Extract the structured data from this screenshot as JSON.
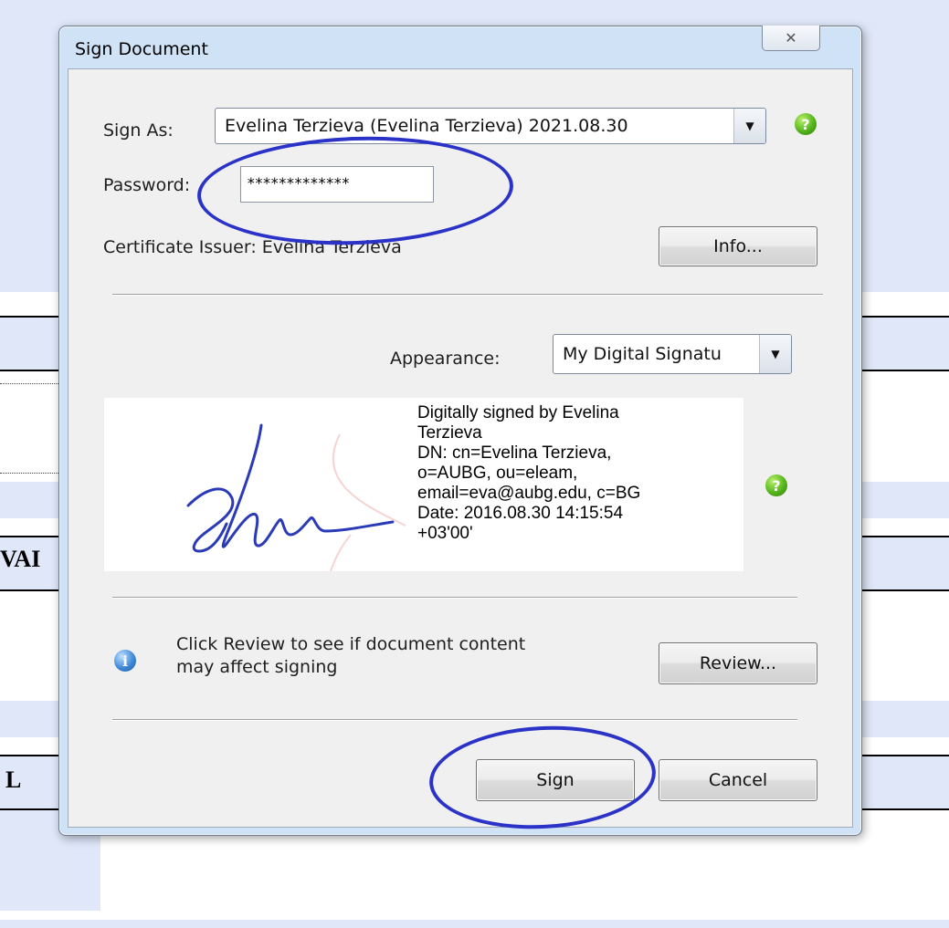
{
  "background": {
    "text_fragment_1": "VAI",
    "text_fragment_2": "L"
  },
  "dialog": {
    "title": "Sign Document",
    "close_glyph": "✕",
    "sign_as_label": "Sign As:",
    "sign_as_value": "Evelina  Terzieva (Evelina  Terzieva) 2021.08.30",
    "password_label": "Password:",
    "password_value": "*************",
    "certificate_issuer_label": "Certificate Issuer: Evelina  Terzieva",
    "info_button": "Info...",
    "appearance_label": "Appearance:",
    "appearance_value": "My Digital Signatu",
    "signature_preview": {
      "lines": [
        "Digitally signed by Evelina",
        "Terzieva",
        "DN: cn=Evelina  Terzieva,",
        "o=AUBG, ou=eleam,",
        "email=eva@aubg.edu, c=BG",
        "Date: 2016.08.30 14:15:54",
        "+03'00'"
      ]
    },
    "review_message_line1": "Click Review to see if document content",
    "review_message_line2": "may affect signing",
    "review_button": "Review...",
    "sign_button": "Sign",
    "cancel_button": "Cancel",
    "help_glyph": "?",
    "info_glyph": "i",
    "dropdown_glyph": "▼"
  },
  "colors": {
    "annotation": "#2a32c8",
    "help_icon": "#56b51c",
    "info_icon": "#3f8ad8",
    "signature_ink": "#2b3bb8"
  },
  "icons": {
    "help": "help-icon",
    "info": "info-icon",
    "close": "close-icon",
    "dropdown": "chevron-down-icon"
  }
}
